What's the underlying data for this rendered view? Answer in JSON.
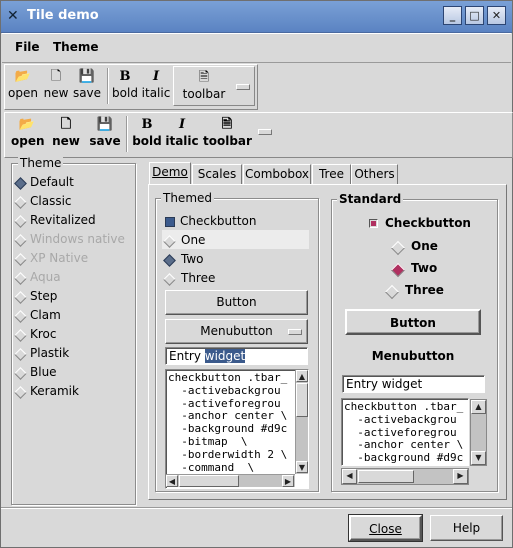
{
  "window": {
    "title": "Tile demo"
  },
  "titlebar_buttons": {
    "minimize": "_",
    "maximize": "□",
    "close": "✕"
  },
  "menubar": {
    "file": "File",
    "theme": "Theme"
  },
  "toolbar1": {
    "open": "open",
    "new": "new",
    "save": "save",
    "bold": "bold",
    "italic": "italic",
    "toolbar": "toolbar"
  },
  "toolbar2": {
    "open": "open",
    "new": "new",
    "save": "save",
    "bold": "bold",
    "italic": "italic",
    "toolbar": "toolbar"
  },
  "icons": {
    "open": "📂",
    "new": "🗋",
    "save": "💾",
    "bold": "B",
    "italic": "I",
    "toolbar": "🗎"
  },
  "theme": {
    "label": "Theme",
    "selected": "Default",
    "items": [
      {
        "label": "Default",
        "disabled": false
      },
      {
        "label": "Classic",
        "disabled": false
      },
      {
        "label": "Revitalized",
        "disabled": false
      },
      {
        "label": "Windows native",
        "disabled": true
      },
      {
        "label": "XP Native",
        "disabled": true
      },
      {
        "label": "Aqua",
        "disabled": true
      },
      {
        "label": "Step",
        "disabled": false
      },
      {
        "label": "Clam",
        "disabled": false
      },
      {
        "label": "Kroc",
        "disabled": false
      },
      {
        "label": "Plastik",
        "disabled": false
      },
      {
        "label": "Blue",
        "disabled": false
      },
      {
        "label": "Keramik",
        "disabled": false
      }
    ]
  },
  "tabs": [
    "Demo",
    "Scales",
    "Combobox",
    "Tree",
    "Others"
  ],
  "active_tab": "Demo",
  "themed": {
    "label": "Themed",
    "checkbutton": "Checkbutton",
    "radios": [
      "One",
      "Two",
      "Three"
    ],
    "selected_radio": "Two",
    "button": "Button",
    "menubutton": "Menubutton",
    "entry_value": "Entry ",
    "entry_selected": "widget"
  },
  "standard": {
    "label": "Standard",
    "checkbutton": "Checkbutton",
    "radios": [
      "One",
      "Two",
      "Three"
    ],
    "selected_radio": "Two",
    "button": "Button",
    "menubutton": "Menubutton",
    "entry_value": "Entry widget"
  },
  "text_lines": [
    "checkbutton .tbar_",
    "  -activebackgrou",
    "  -activeforegrou",
    "  -anchor center \\",
    "  -background #d9c",
    "  -bitmap  \\",
    "  -borderwidth 2 \\",
    "  -command  \\"
  ],
  "text_lines_std": [
    "checkbutton .tbar_",
    "  -activebackgrou",
    "  -activeforegrou",
    "  -anchor center \\",
    "  -background #d9c"
  ],
  "buttons": {
    "close": "Close",
    "help": "Help"
  },
  "colors": {
    "titlebar": "#6a90cc",
    "accent": "#3b5a8c",
    "check_std": "#b03060"
  }
}
